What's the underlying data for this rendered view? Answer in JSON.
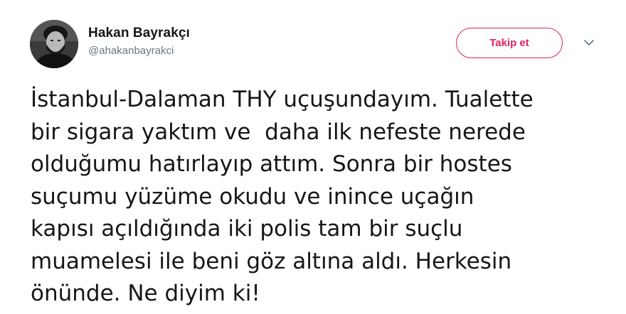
{
  "user": {
    "display_name": "Hakan Bayrakçı",
    "handle": "@ahakanbayrakci"
  },
  "actions": {
    "follow_label": "Takip et",
    "caret_icon": "chevron-down-icon"
  },
  "tweet": {
    "lines": [
      "İstanbul-Dalaman THY uçuşundayım. Tualette",
      "bir sigara yaktım ve  daha ilk nefeste nerede",
      "olduğumu hatırlayıp attım. Sonra bir hostes",
      "suçumu yüzüme okudu ve inince uçağın",
      "kapısı açıldığında iki polis tam bir suçlu",
      "muamelesi ile beni göz altına aldı. Herkesin",
      "önünde. Ne diyim ki!"
    ]
  },
  "colors": {
    "follow_accent": "#e0245e",
    "handle_gray": "#657786",
    "text": "#14171a"
  }
}
